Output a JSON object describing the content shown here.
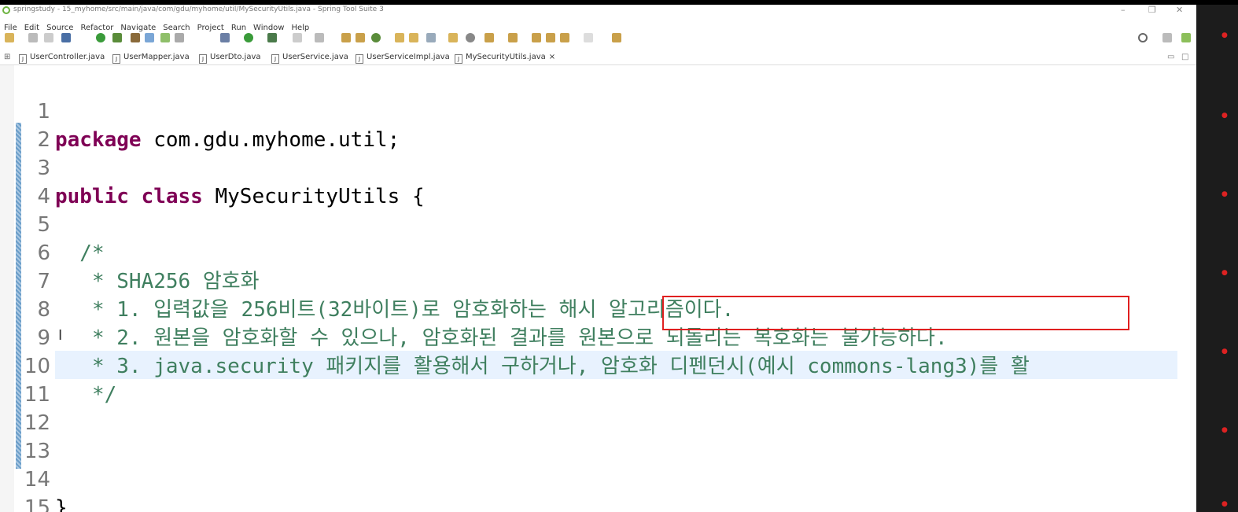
{
  "window": {
    "title": "springstudy - 15_myhome/src/main/java/com/gdu/myhome/util/MySecurityUtils.java - Spring Tool Suite 3",
    "minimize": "–",
    "restore": "❐",
    "close": "✕"
  },
  "menu": [
    "File",
    "Edit",
    "Source",
    "Refactor",
    "Navigate",
    "Search",
    "Project",
    "Run",
    "Window",
    "Help"
  ],
  "tabs": [
    {
      "label": "UserController.java"
    },
    {
      "label": "UserMapper.java"
    },
    {
      "label": "UserDto.java"
    },
    {
      "label": "UserService.java"
    },
    {
      "label": "UserServiceImpl.java"
    },
    {
      "label": "MySecurityUtils.java",
      "close": "×"
    }
  ],
  "colors": {
    "keyword": "#7f0055",
    "comment": "#3f7f5f",
    "highlight_box": "#e02020",
    "current_line": "#e8f2fe"
  },
  "code": {
    "lines": [
      {
        "n": "1",
        "kw": "package",
        "text": " com.gdu.myhome.util;"
      },
      {
        "n": "2",
        "kw": "",
        "text": ""
      },
      {
        "n": "3",
        "kw": "public class",
        "text": " MySecurityUtils {"
      },
      {
        "n": "4",
        "kw": "",
        "text": ""
      },
      {
        "n": "5",
        "kw": "",
        "cm": "  /*"
      },
      {
        "n": "6",
        "kw": "",
        "cm": "   * SHA256 암호화"
      },
      {
        "n": "7",
        "kw": "",
        "cm": "   * 1. 입력값을 256비트(32바이트)로 암호화하는 해시 알고리즘이다."
      },
      {
        "n": "8",
        "kw": "",
        "cm": "   * 2. 원본을 암호화할 수 있으나, 암호화된 결과를 원본으로 되돌리는 복호화는 불가능하다."
      },
      {
        "n": "9",
        "kw": "",
        "cm": "   * 3. java.security 패키지를 활용해서 구하거나, 암호화 디펜던시(예시 commons-lang3)를 활"
      },
      {
        "n": "10",
        "kw": "",
        "cm": "   */"
      },
      {
        "n": "11",
        "kw": "",
        "text": ""
      },
      {
        "n": "12",
        "kw": "",
        "text": ""
      },
      {
        "n": "13",
        "kw": "",
        "text": ""
      },
      {
        "n": "14",
        "kw": "",
        "text": "}"
      },
      {
        "n": "15",
        "kw": "",
        "text": ""
      }
    ]
  }
}
